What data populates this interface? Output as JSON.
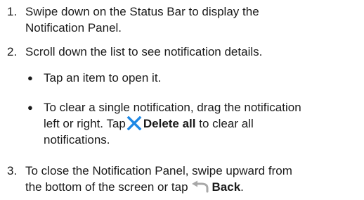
{
  "steps": [
    {
      "number": "1.",
      "line1": "Swipe down on the Status Bar to display the",
      "line2": "Notification Panel."
    },
    {
      "number": "2.",
      "text": "Scroll down the list to see notification details."
    },
    {
      "number": "3.",
      "line1": "To close the Notification Panel, swipe upward from",
      "line2_pre": "the bottom of the screen or tap",
      "line2_bold": "Back",
      "line2_post": "."
    }
  ],
  "bullets": [
    {
      "symbol": "●",
      "text": "Tap an item to open it."
    },
    {
      "symbol": "●",
      "line1": "To clear a single notification, drag the notification",
      "line2_pre": "left or right. Tap",
      "line2_bold": "Delete all",
      "line2_post": " to clear all",
      "line3": "notifications."
    }
  ],
  "icons": {
    "delete_all": "close-x-icon",
    "back": "back-arrow-icon"
  },
  "colors": {
    "text": "#1a1a1a",
    "x_icon": "#1e88e5",
    "back_icon": "#a8a8a8"
  }
}
